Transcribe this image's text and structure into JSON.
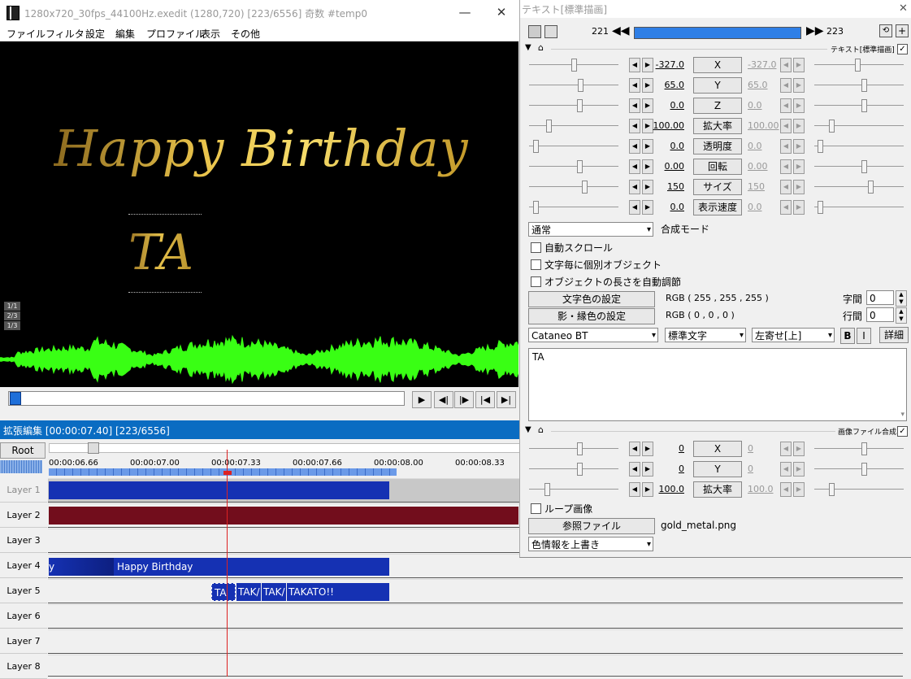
{
  "main_window": {
    "title": "1280x720_30fps_44100Hz.exedit (1280,720)  [223/6556]  奇数  #temp0",
    "menu": [
      "ファイル",
      "フィルタ",
      "設定",
      "編集",
      "プロファイル",
      "表示",
      "その他"
    ],
    "min_symbol": "—",
    "max_symbol": "☐",
    "close_symbol": "✕"
  },
  "preview": {
    "text_main": "Happy Birthday",
    "text_sub": "TA",
    "page_indicators": [
      "1/1",
      "2/3",
      "1/3"
    ]
  },
  "playback": {
    "buttons": [
      "▶",
      "◀|",
      "|▶",
      "|◀",
      "▶|"
    ],
    "waveform_color": "#39ff14"
  },
  "timeline": {
    "title": "拡張編集 [00:00:07.40] [223/6556]",
    "root_label": "Root",
    "ticks": [
      "00:00:06.66",
      "00:00:07.00",
      "00:00:07.33",
      "00:00:07.66",
      "00:00:08.00",
      "00:00:08.33"
    ],
    "layers": [
      "Layer 1",
      "Layer 2",
      "Layer 3",
      "Layer 4",
      "Layer 5",
      "Layer 6",
      "Layer 7",
      "Layer 8"
    ],
    "clip_layer4_left": "y",
    "clip_layer4_main": "Happy Birthday",
    "clip_layer5_a": "TA",
    "clip_layer5_b": "TAK/",
    "clip_layer5_c": "TAK/",
    "clip_layer5_d": "TAKATO!!"
  },
  "dialog": {
    "title": "テキスト[標準描画]",
    "frame_start": "221",
    "frame_end": "223",
    "section_text": "テキスト[標準描画]",
    "params": [
      {
        "label": "X",
        "value": "-327.0",
        "end": "-327.0"
      },
      {
        "label": "Y",
        "value": "65.0",
        "end": "65.0"
      },
      {
        "label": "Z",
        "value": "0.0",
        "end": "0.0"
      },
      {
        "label": "拡大率",
        "value": "100.00",
        "end": "100.00"
      },
      {
        "label": "透明度",
        "value": "0.0",
        "end": "0.0"
      },
      {
        "label": "回転",
        "value": "0.00",
        "end": "0.00"
      },
      {
        "label": "サイズ",
        "value": "150",
        "end": "150"
      },
      {
        "label": "表示速度",
        "value": "0.0",
        "end": "0.0"
      }
    ],
    "blend_mode_value": "通常",
    "blend_mode_label": "合成モード",
    "checkboxes": [
      "自動スクロール",
      "文字毎に個別オブジェクト",
      "オブジェクトの長さを自動調節"
    ],
    "text_color_btn": "文字色の設定",
    "text_color_value": "RGB ( 255 , 255 , 255 )",
    "shadow_color_btn": "影・縁色の設定",
    "shadow_color_value": "RGB ( 0 , 0 , 0 )",
    "char_spacing_label": "字間",
    "char_spacing_value": "0",
    "line_spacing_label": "行間",
    "line_spacing_value": "0",
    "font": "Cataneo BT",
    "font_style": "標準文字",
    "align": "左寄せ[上]",
    "bold_label": "B",
    "italic_label": "I",
    "detail_label": "詳細",
    "text_content": "TA",
    "section_image": "画像ファイル合成",
    "img_params": [
      {
        "label": "X",
        "value": "0",
        "end": "0"
      },
      {
        "label": "Y",
        "value": "0",
        "end": "0"
      },
      {
        "label": "拡大率",
        "value": "100.0",
        "end": "100.0"
      }
    ],
    "loop_label": "ループ画像",
    "ref_file_btn": "参照ファイル",
    "ref_file_value": "gold_metal.png",
    "color_mode": "色情報を上書き"
  },
  "colors": {
    "timeline_title_bg": "#0a6cc2",
    "clip_blue": "#1531b3",
    "clip_red": "#720d1c",
    "frame_bar": "#2f7fe6"
  }
}
